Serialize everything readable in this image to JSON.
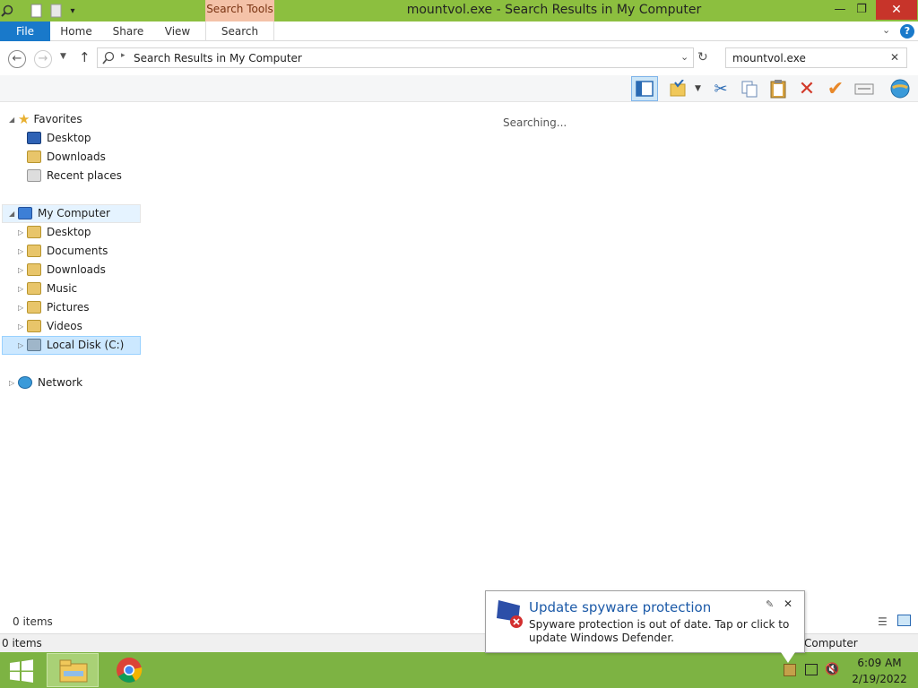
{
  "window": {
    "title": "mountvol.exe - Search Results in My Computer",
    "context_tab": "Search Tools"
  },
  "ribbon": {
    "tabs": [
      "File",
      "Home",
      "Share",
      "View",
      "Search"
    ]
  },
  "address": {
    "path": "Search Results in My Computer",
    "search_value": "mountvol.exe"
  },
  "nav": {
    "favorites": {
      "label": "Favorites",
      "items": [
        "Desktop",
        "Downloads",
        "Recent places"
      ]
    },
    "computer": {
      "label": "My Computer",
      "items": [
        "Desktop",
        "Documents",
        "Downloads",
        "Music",
        "Pictures",
        "Videos",
        "Local Disk (C:)"
      ]
    },
    "network": {
      "label": "Network"
    }
  },
  "content": {
    "status": "Searching..."
  },
  "status": {
    "items_top": "0 items",
    "items_bottom": "0 items",
    "right": "Computer"
  },
  "toast": {
    "title": "Update spyware protection",
    "body": "Spyware protection is out of date. Tap or click to update Windows Defender."
  },
  "taskbar": {
    "time": "6:09 AM",
    "date": "2/19/2022"
  },
  "colors": {
    "titlebar": "#8cbf3f",
    "file_tab": "#1979ca",
    "taskbar": "#7db343",
    "context_tab": "#f4c2a8"
  }
}
